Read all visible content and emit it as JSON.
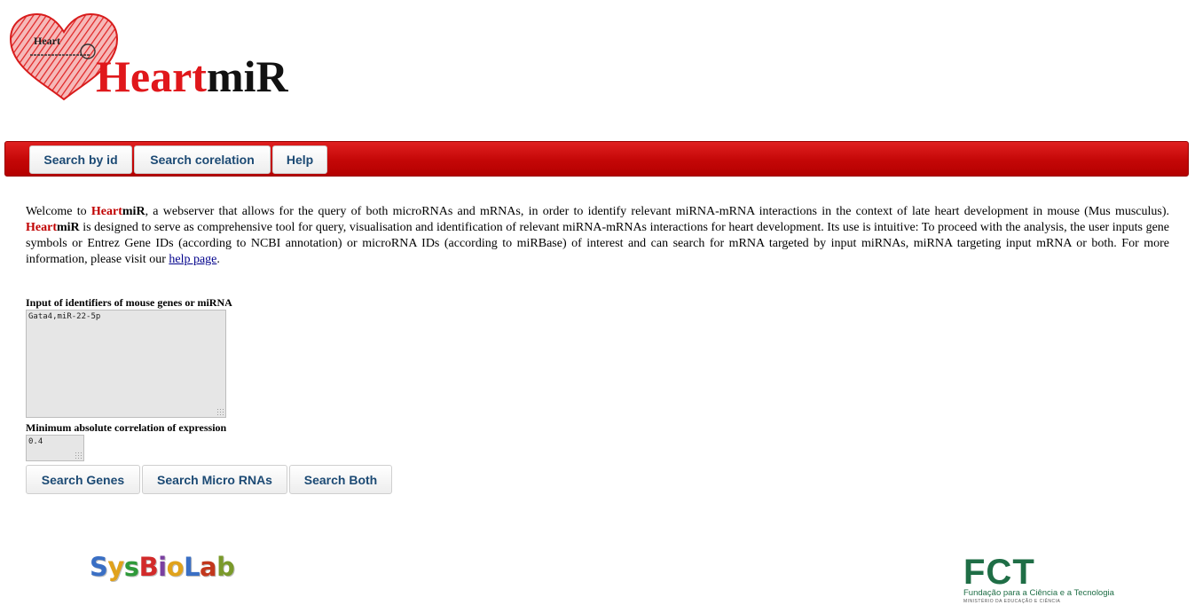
{
  "logo": {
    "word_red": "Heart",
    "word_black": "miR",
    "mini_text": "Heart"
  },
  "nav": {
    "items": [
      {
        "label": "Search by id"
      },
      {
        "label": "Search corelation"
      },
      {
        "label": "Help"
      }
    ]
  },
  "intro": {
    "welcome": "Welcome to",
    "brand_red": "Heart",
    "brand_black": "miR",
    "part1": ", a webserver that allows for the query of both microRNAs and mRNAs, in order to identify relevant miRNA-mRNA interactions in the context of late heart development in mouse (Mus musculus).",
    "part2": " is designed to serve as comprehensive tool for query, visualisation and identification of relevant miRNA-mRNAs interactions for heart development. Its use is intuitive: To proceed with the analysis, the user inputs gene symbols or Entrez Gene IDs (according to NCBI annotation) or microRNA IDs (according to miRBase) of interest and can search for mRNA targeted by input miRNAs, miRNA targeting input mRNA or both. For more information, please visit our",
    "link": "help page",
    "end": "."
  },
  "form": {
    "ids_label": "Input of identifiers of mouse genes or miRNA",
    "ids_value": "Gata4,miR-22-5p",
    "corr_label": "Minimum absolute correlation of expression",
    "corr_value": "0.4",
    "buttons": {
      "genes": "Search Genes",
      "micro": "Search Micro RNAs",
      "both": "Search Both"
    }
  },
  "footer": {
    "sysbiolab_letters": [
      "S",
      "y",
      "s",
      "B",
      "i",
      "o",
      "L",
      "a",
      "b"
    ],
    "sysbiolab_colors": [
      "#3a6fc4",
      "#e0a21b",
      "#2f9a3a",
      "#d22a2a",
      "#7a3fa0",
      "#e0a21b",
      "#3a6fc4",
      "#c2371c",
      "#7a9a2a"
    ],
    "fct_big": "FCT",
    "fct_sub": "Fundação para a Ciência e a Tecnologia",
    "fct_tiny": "MINISTÉRIO DA EDUCAÇÃO E CIÊNCIA"
  },
  "colors": {
    "navbar": "#c40707",
    "brand_red": "#e0171b",
    "button_text": "#1c4a74",
    "fct_green": "#1f6e46"
  }
}
